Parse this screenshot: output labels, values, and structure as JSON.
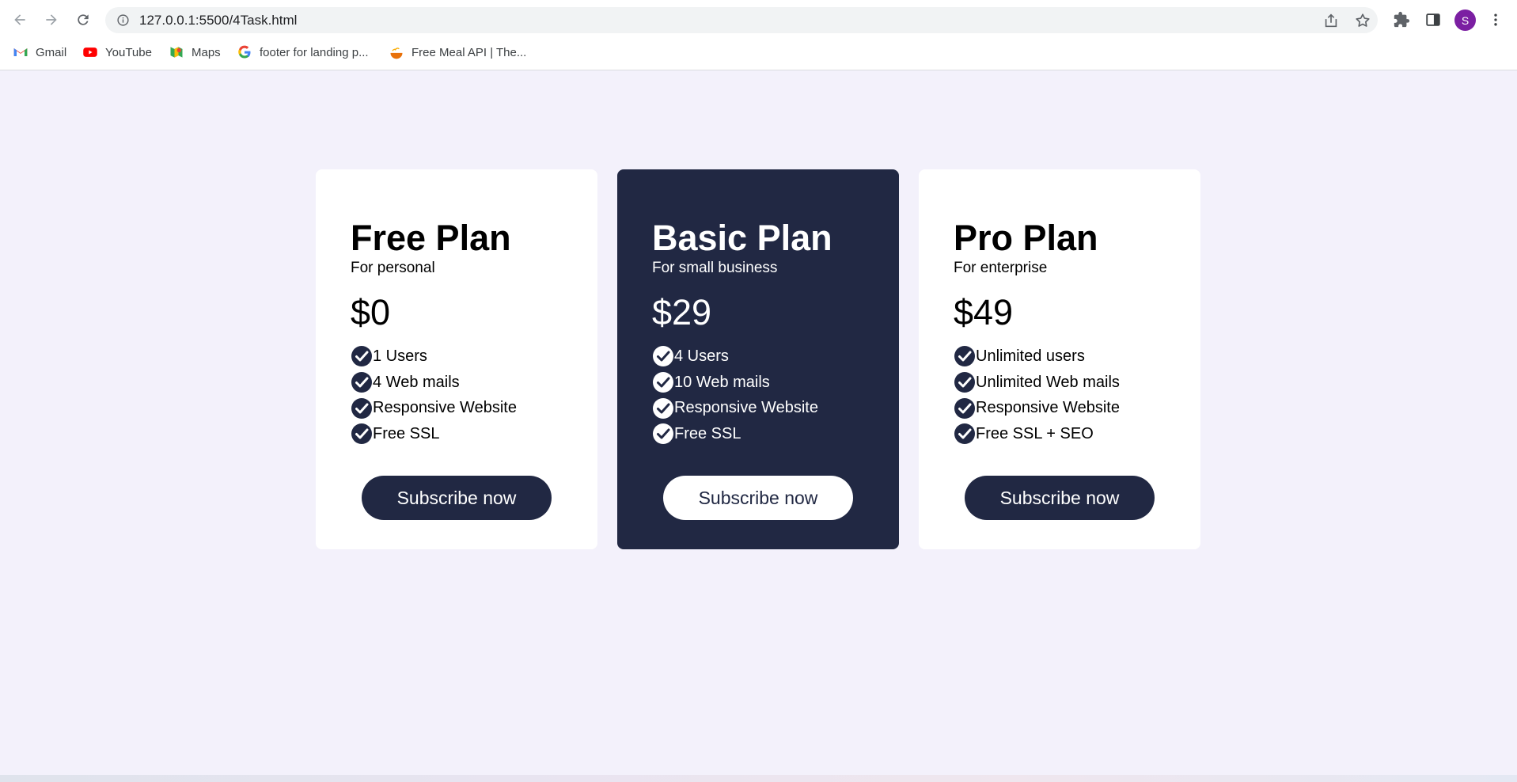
{
  "browser": {
    "url": "127.0.0.1:5500/4Task.html",
    "avatar_letter": "S",
    "bookmarks": [
      {
        "label": "Gmail",
        "icon": "gmail-icon"
      },
      {
        "label": "YouTube",
        "icon": "youtube-icon"
      },
      {
        "label": "Maps",
        "icon": "maps-icon"
      },
      {
        "label": "footer for landing p...",
        "icon": "google-icon"
      },
      {
        "label": "Free Meal API | The...",
        "icon": "meal-icon"
      }
    ]
  },
  "theme": {
    "background": "#f3f1fb",
    "dark": "#212843",
    "light": "#ffffff",
    "avatar": "#7b1fa2"
  },
  "plans": [
    {
      "name": "Free Plan",
      "subtitle": "For personal",
      "price": "$0",
      "features": [
        "1 Users",
        "4 Web mails",
        "Responsive Website",
        "Free SSL"
      ],
      "button": "Subscribe now",
      "style": "light"
    },
    {
      "name": "Basic Plan",
      "subtitle": "For small business",
      "price": "$29",
      "features": [
        "4 Users",
        "10 Web mails",
        "Responsive Website",
        "Free SSL"
      ],
      "button": "Subscribe now",
      "style": "dark"
    },
    {
      "name": "Pro Plan",
      "subtitle": "For enterprise",
      "price": "$49",
      "features": [
        "Unlimited users",
        "Unlimited Web mails",
        "Responsive Website",
        "Free SSL + SEO"
      ],
      "button": "Subscribe now",
      "style": "light"
    }
  ]
}
